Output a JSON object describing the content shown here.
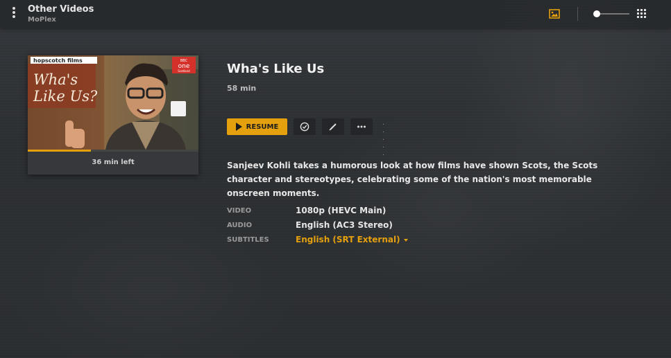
{
  "header": {
    "title": "Other Videos",
    "subtitle": "MoPlex",
    "icons": [
      "more-vertical-icon",
      "poster-icon",
      "size-slider",
      "grid-icon"
    ],
    "accent_color": "#e5a00d",
    "size_slider_level": 0.05
  },
  "poster": {
    "studio_text": "hopscotch films",
    "channel_badge": "one",
    "channel_badge_top": "BBC",
    "channel_badge_bottom": "Scotland",
    "poster_caption_line1": "Wha's",
    "poster_caption_line2": "Like Us?",
    "progress_fraction": 0.37,
    "time_left": "36 min left"
  },
  "media": {
    "title": "Wha's Like Us",
    "duration": "58 min",
    "summary": "Sanjeev Kohli takes a humorous look at how films have shown Scots, the Scots character and stereotypes, celebrating some of the nation's most memorable onscreen moments."
  },
  "actions": {
    "resume_label": "RESUME",
    "watched_icon": "check-circle-icon",
    "edit_icon": "pencil-icon",
    "more_icon": "more-horizontal-icon",
    "dots": "· · · · ·"
  },
  "meta": {
    "video_label": "VIDEO",
    "video_value": "1080p (HEVC Main)",
    "audio_label": "AUDIO",
    "audio_value": "English (AC3 Stereo)",
    "subtitles_label": "SUBTITLES",
    "subtitles_value": "English (SRT External)"
  }
}
